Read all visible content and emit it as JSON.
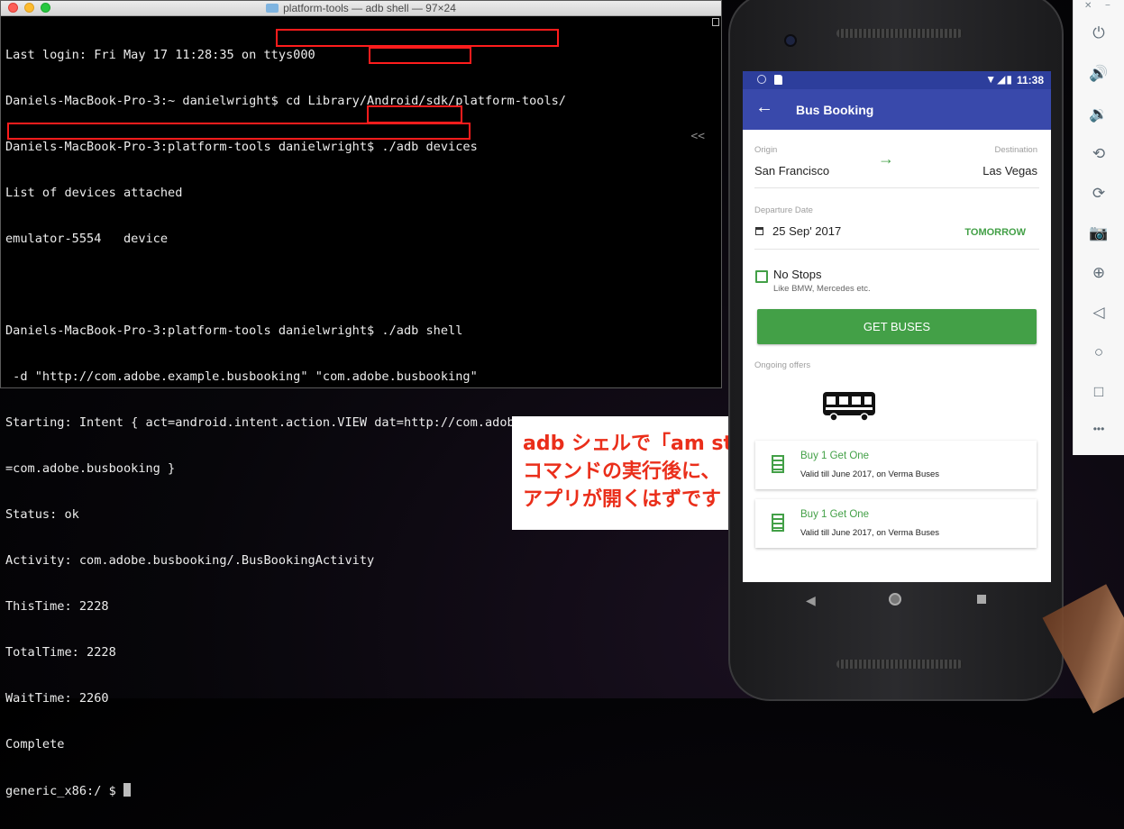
{
  "terminal": {
    "title": "platform-tools — adb shell — 97×24",
    "lines": [
      "Last login: Fri May 17 11:28:35 on ttys000",
      "Daniels-MacBook-Pro-3:~ danielwright$ cd Library/Android/sdk/platform-tools/",
      "Daniels-MacBook-Pro-3:platform-tools danielwright$ ./adb devices",
      "List of devices attached",
      "emulator-5554   device",
      "",
      "Daniels-MacBook-Pro-3:platform-tools danielwright$ ./adb shell",
      " -d \"http://com.adobe.example.busbooking\" \"com.adobe.busbooking\"",
      "Starting: Intent { act=android.intent.action.VIEW dat=http://com.adobe.example.busbooking/... pkg",
      "=com.adobe.busbooking }",
      "Status: ok",
      "Activity: com.adobe.busbooking/.BusBookingActivity",
      "ThisTime: 2228",
      "TotalTime: 2228",
      "WaitTime: 2260",
      "Complete",
      "generic_x86:/ $ "
    ],
    "overflow_marker": "<<"
  },
  "callout": {
    "lines": [
      "adb シェルで「am start」",
      "コマンドの実行後に、",
      "アプリが開くはずです"
    ],
    "color": "#ea2e1a"
  },
  "phone": {
    "status_time": "11:38",
    "status_icons": "▼◢▮",
    "app_title": "Bus Booking",
    "origin_label": "Origin",
    "origin_value": "San Francisco",
    "destination_label": "Destination",
    "destination_value": "Las Vegas",
    "departure_label": "Departure Date",
    "departure_value": "25 Sep' 2017",
    "tomorrow_label": "TOMORROW",
    "no_stops_label": "No Stops",
    "no_stops_sub": "Like BMW, Mercedes etc.",
    "get_buses_label": "GET BUSES",
    "ongoing_label": "Ongoing offers",
    "offers": [
      {
        "title": "Buy 1 Get One",
        "subtitle_prefix": "Valid till June 2017, on ",
        "subtitle_operator": "Verma Buses"
      },
      {
        "title": "Buy 1 Get One",
        "subtitle_prefix": "Valid till June 2017, on ",
        "subtitle_operator": "Verma Buses"
      }
    ],
    "accent_color": "#3949ab",
    "green_color": "#43a047"
  },
  "sidepanel": {
    "close_glyph": "✕",
    "minimize_glyph": "−",
    "more_glyph": "•••"
  }
}
